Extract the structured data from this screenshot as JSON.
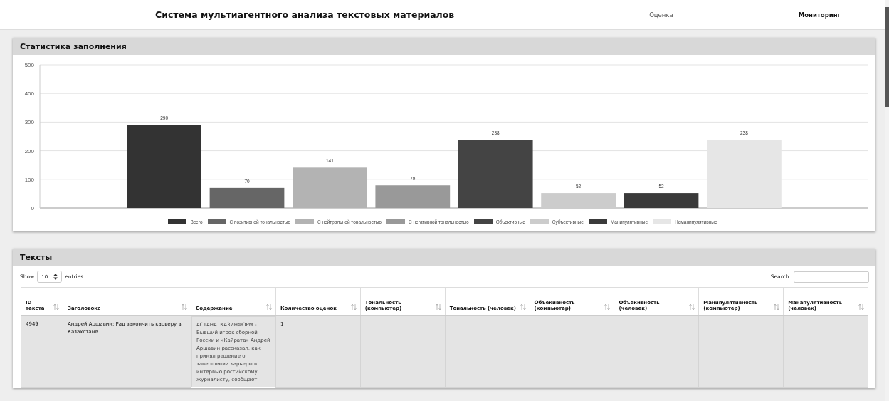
{
  "header": {
    "title": "Система мультиагентного анализа текстовых материалов",
    "nav": [
      {
        "label": "Оценка",
        "selected": false
      },
      {
        "label": "Мониторинг",
        "selected": true
      }
    ]
  },
  "stats_panel": {
    "title": "Статистика заполнения",
    "chart_data": {
      "type": "bar",
      "grid": true,
      "legend": true,
      "ylim": [
        0,
        500
      ],
      "yticks": [
        0,
        100,
        200,
        300,
        400,
        500
      ],
      "data_labels": true,
      "series": [
        {
          "name": "Всего",
          "color": "#333333",
          "values": [
            290
          ]
        },
        {
          "name": "С позитивной тональностью",
          "color": "#666666",
          "values": [
            70
          ]
        },
        {
          "name": "С нейтральной тональностью",
          "color": "#b3b3b3",
          "values": [
            141
          ]
        },
        {
          "name": "С негативной тональностью",
          "color": "#999999",
          "values": [
            79
          ]
        },
        {
          "name": "Объективные",
          "color": "#444444",
          "values": [
            238
          ]
        },
        {
          "name": "Субъективные",
          "color": "#cccccc",
          "values": [
            52
          ]
        },
        {
          "name": "Манипулятивные",
          "color": "#3a3a3a",
          "values": [
            52
          ]
        },
        {
          "name": "Неманипулятивные",
          "color": "#e6e6e6",
          "values": [
            238
          ]
        }
      ]
    }
  },
  "texts_panel": {
    "title": "Тексты",
    "length_label_before": "Show",
    "page_length": "10",
    "length_label_after": "entries",
    "search_label": "Search:",
    "table": {
      "columns": [
        "ID текста",
        "Заголовокс",
        "Содержание",
        "Количество оценок",
        "Тональность (компьютер)",
        "Тональность (человек)",
        "Объекивность (компьютер)",
        "Объекивность (человек)",
        "Манипулятивность (компьютер)",
        "Манапулятивность (человек)"
      ],
      "rows": [
        [
          "4949",
          "Андрей Аршавин: Рад закончить карьеру в Казахстане",
          "АСТАНА. КАЗИНФОРМ - Бывший игрок сборной России и «Кайрата» Андрей Аршавин рассказал, как принял решение о завершении карьеры в интервью российскому журналисту, сообщает",
          "1"
        ]
      ]
    }
  }
}
